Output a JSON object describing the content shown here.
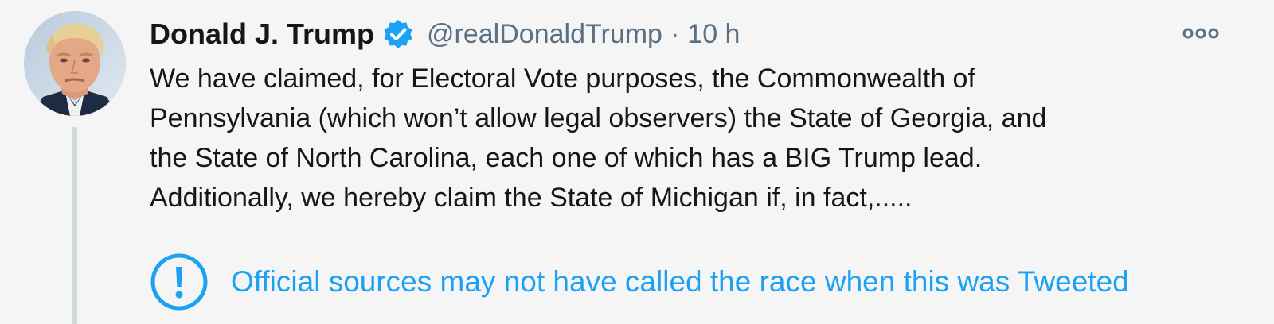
{
  "tweet": {
    "author": {
      "display_name": "Donald J. Trump",
      "handle": "@realDonaldTrump",
      "verified": true,
      "avatar": "profile-photo"
    },
    "separator": "·",
    "timestamp": "10 h",
    "more_icon": "more-horizontal-icon",
    "text": "We have claimed, for Electoral Vote purposes, the Commonwealth of\nPennsylvania (which won’t allow legal observers) the State of Georgia, and\nthe State of North Carolina, each one of which has a BIG Trump lead.\nAdditionally, we hereby claim the State of Michigan if, in fact,.....",
    "notice": {
      "icon": "exclamation-circle-icon",
      "text": "Official sources may not have called the race when this was Tweeted"
    }
  },
  "colors": {
    "background": "#f5f5f5",
    "text_primary": "#14171a",
    "text_secondary": "#5b7083",
    "accent_blue": "#1da1f2",
    "thread_line": "#cfd9de"
  }
}
